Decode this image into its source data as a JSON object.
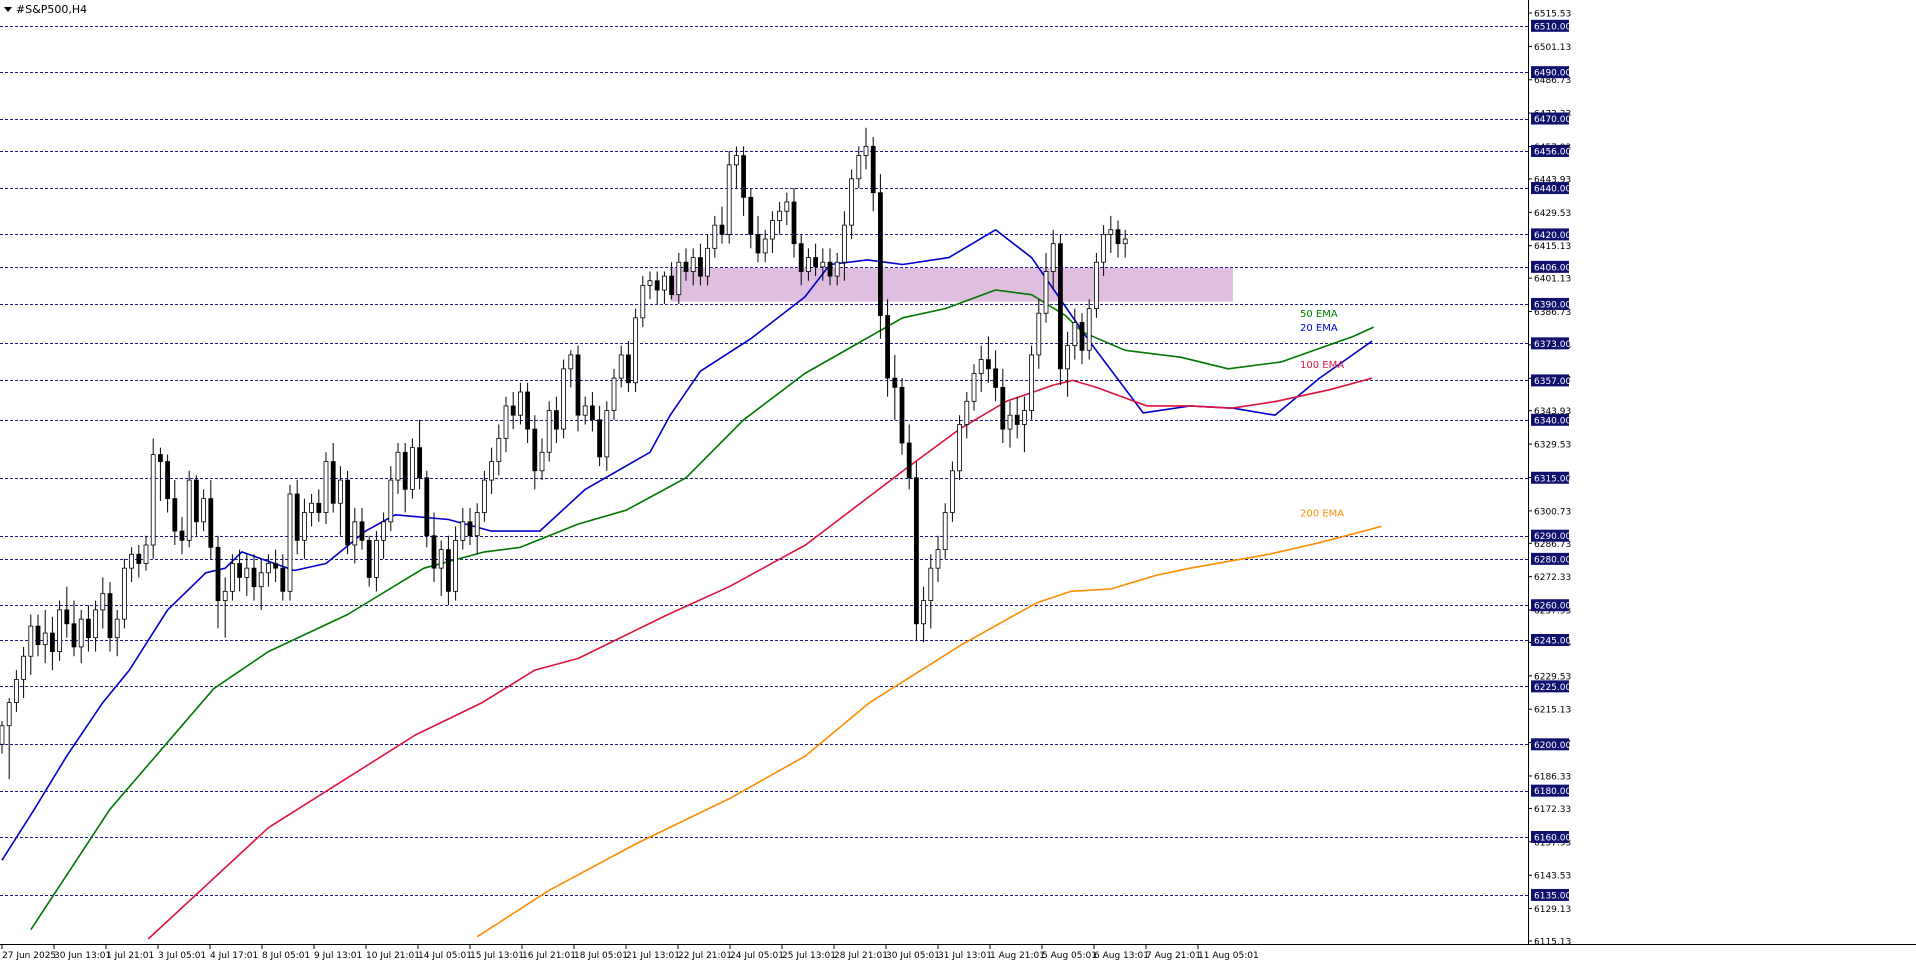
{
  "window": {
    "title": "#S&P500,H4"
  },
  "chart_data": {
    "type": "candlestick",
    "symbol": "#S&P500",
    "timeframe": "H4",
    "ylim": [
      6115.13,
      6522.0
    ],
    "y_ticks": [
      6515.53,
      6501.13,
      6486.73,
      6472.33,
      6457.93,
      6443.93,
      6429.53,
      6415.13,
      6401.13,
      6386.73,
      6372.33,
      6357.93,
      6343.93,
      6329.53,
      6315.13,
      6300.73,
      6286.73,
      6272.33,
      6257.93,
      6243.93,
      6229.53,
      6215.13,
      6200.73,
      6186.33,
      6172.33,
      6157.93,
      6143.53,
      6129.13,
      6115.13
    ],
    "y_tick_labels": [
      "6515.53",
      "6501.13",
      "6486.73",
      "6472.33",
      "6457.93",
      "6443.93",
      "6429.53",
      "6415.13",
      "6401.13",
      "6386.73",
      "6372.33",
      "6357.93",
      "6343.93",
      "6329.53",
      "6315.13",
      "6300.73",
      "6286.73",
      "6272.33",
      "6257.93",
      "6243.93",
      "6229.53",
      "6215.13",
      "6200.73",
      "6186.33",
      "6172.33",
      "6157.93",
      "6143.53",
      "6129.13",
      "6115.13"
    ],
    "levels": [
      6510.0,
      6490.0,
      6470.0,
      6456.0,
      6440.0,
      6420.0,
      6406.0,
      6390.0,
      6373.0,
      6357.0,
      6340.0,
      6315.0,
      6290.0,
      6280.0,
      6260.0,
      6245.0,
      6225.0,
      6200.0,
      6180.0,
      6160.0,
      6135.0
    ],
    "level_labels": [
      "6510.00",
      "6490.00",
      "6470.00",
      "6456.00",
      "6440.00",
      "6420.00",
      "6406.00",
      "6390.00",
      "6373.00",
      "6357.00",
      "6340.00",
      "6315.00",
      "6290.00",
      "6280.00",
      "6260.00",
      "6245.00",
      "6225.00",
      "6200.00",
      "6180.00",
      "6160.00",
      "6135.00"
    ],
    "x_labels": [
      "27 Jun 2025",
      "30 Jun 13:01",
      "1 Jul 21:01",
      "3 Jul 05:01",
      "4 Jul 17:01",
      "8 Jul 05:01",
      "9 Jul 13:01",
      "10 Jul 21:01",
      "14 Jul 05:01",
      "15 Jul 13:01",
      "16 Jul 21:01",
      "18 Jul 05:01",
      "21 Jul 13:01",
      "22 Jul 21:01",
      "24 Jul 05:01",
      "25 Jul 13:01",
      "28 Jul 21:01",
      "30 Jul 05:01",
      "31 Jul 13:01",
      "1 Aug 21:01",
      "5 Aug 05:01",
      "6 Aug 13:01",
      "7 Aug 21:01",
      "11 Aug 05:01"
    ],
    "zone": {
      "low": 6391.0,
      "high": 6405.5
    },
    "series": [
      {
        "name": "20 EMA",
        "color": "#0000cc",
        "x": [
          0,
          4.5,
          9,
          14,
          17.7,
          23,
          28.3,
          31,
          33.3,
          40.6,
          45,
          50.5,
          54.6,
          62,
          68,
          74.7,
          81,
          90,
          92.8,
          97,
          104,
          111.5,
          115,
          120.2,
          125.1,
          131.5,
          138,
          143,
          151,
          158.5,
          165,
          171,
          176.8,
          183,
          190.3
        ],
        "y": [
          6150,
          6172,
          6195,
          6218,
          6232,
          6258,
          6274,
          6276,
          6283,
          6275,
          6278,
          6292,
          6299,
          6297,
          6292,
          6292,
          6310,
          6326,
          6342,
          6361,
          6375,
          6393,
          6407,
          6409,
          6407,
          6410,
          6422,
          6410,
          6374,
          6343,
          6346,
          6345,
          6342,
          6358,
          6374
        ]
      },
      {
        "name": "50 EMA",
        "color": "#007700",
        "x": [
          4,
          15,
          29.4,
          37,
          48,
          58.6,
          67,
          72,
          80,
          86.7,
          95,
          103,
          111.5,
          125.1,
          131,
          138,
          143,
          147.7,
          150,
          156,
          163.7,
          170.3,
          177.7,
          187.7,
          190.5
        ],
        "y": [
          6120,
          6172,
          6224,
          6240,
          6256,
          6276,
          6283,
          6285,
          6295,
          6301,
          6315,
          6340,
          6360,
          6384,
          6388,
          6396,
          6394,
          6385,
          6378,
          6370,
          6367,
          6362,
          6365,
          6376,
          6380
        ]
      },
      {
        "name": "100 EMA",
        "color": "#dc143c",
        "x": [
          20.3,
          37,
          57.4,
          66.7,
          74,
          80,
          92.5,
          101,
          111.6,
          126,
          133,
          139.5,
          146,
          148.7,
          152,
          159,
          165,
          170.8,
          177,
          184.4,
          190.3
        ],
        "y": [
          6116,
          6164,
          6204,
          6218,
          6232,
          6237,
          6256,
          6268,
          6286,
          6320,
          6336,
          6348,
          6355,
          6357,
          6354,
          6346,
          6346,
          6345,
          6348,
          6353,
          6358
        ]
      },
      {
        "name": "200 EMA",
        "color": "#ff8c00",
        "x": [
          66,
          76,
          88,
          101.3,
          111.6,
          120.5,
          133.3,
          143.7,
          148.5,
          154,
          160.4,
          165,
          176,
          183,
          191.6
        ],
        "y": [
          6117,
          6137,
          6157,
          6177,
          6195,
          6218,
          6243,
          6261,
          6266,
          6267,
          6273,
          6276,
          6282,
          6287,
          6294
        ]
      }
    ],
    "candles": [
      [
        6200,
        6210,
        6196,
        6208
      ],
      [
        6208,
        6220,
        6185,
        6218
      ],
      [
        6218,
        6232,
        6214,
        6228
      ],
      [
        6228,
        6242,
        6220,
        6238
      ],
      [
        6238,
        6256,
        6230,
        6251
      ],
      [
        6251,
        6256,
        6238,
        6243
      ],
      [
        6243,
        6258,
        6235,
        6248
      ],
      [
        6248,
        6255,
        6232,
        6240
      ],
      [
        6240,
        6262,
        6236,
        6258
      ],
      [
        6258,
        6268,
        6246,
        6252
      ],
      [
        6252,
        6262,
        6238,
        6242
      ],
      [
        6242,
        6258,
        6235,
        6254
      ],
      [
        6254,
        6260,
        6240,
        6246
      ],
      [
        6246,
        6262,
        6240,
        6258
      ],
      [
        6258,
        6272,
        6250,
        6265
      ],
      [
        6265,
        6270,
        6240,
        6246
      ],
      [
        6246,
        6258,
        6238,
        6254
      ],
      [
        6254,
        6280,
        6250,
        6276
      ],
      [
        6276,
        6285,
        6270,
        6282
      ],
      [
        6282,
        6286,
        6272,
        6278
      ],
      [
        6278,
        6290,
        6275,
        6286
      ],
      [
        6286,
        6332,
        6280,
        6325
      ],
      [
        6325,
        6328,
        6305,
        6322
      ],
      [
        6322,
        6325,
        6300,
        6306
      ],
      [
        6306,
        6314,
        6286,
        6292
      ],
      [
        6292,
        6298,
        6282,
        6288
      ],
      [
        6288,
        6318,
        6285,
        6314
      ],
      [
        6314,
        6316,
        6290,
        6296
      ],
      [
        6296,
        6310,
        6292,
        6306
      ],
      [
        6306,
        6314,
        6280,
        6285
      ],
      [
        6285,
        6290,
        6250,
        6262
      ],
      [
        6262,
        6272,
        6246,
        6266
      ],
      [
        6266,
        6282,
        6262,
        6278
      ],
      [
        6278,
        6284,
        6266,
        6272
      ],
      [
        6272,
        6282,
        6264,
        6276
      ],
      [
        6276,
        6282,
        6262,
        6268
      ],
      [
        6268,
        6280,
        6258,
        6274
      ],
      [
        6274,
        6282,
        6268,
        6278
      ],
      [
        6278,
        6284,
        6270,
        6276
      ],
      [
        6276,
        6282,
        6262,
        6266
      ],
      [
        6266,
        6312,
        6262,
        6308
      ],
      [
        6308,
        6314,
        6282,
        6288
      ],
      [
        6288,
        6306,
        6280,
        6300
      ],
      [
        6300,
        6308,
        6294,
        6304
      ],
      [
        6304,
        6310,
        6296,
        6300
      ],
      [
        6300,
        6326,
        6295,
        6322
      ],
      [
        6322,
        6330,
        6300,
        6304
      ],
      [
        6304,
        6320,
        6290,
        6314
      ],
      [
        6314,
        6318,
        6282,
        6286
      ],
      [
        6286,
        6302,
        6278,
        6296
      ],
      [
        6296,
        6302,
        6284,
        6288
      ],
      [
        6288,
        6290,
        6268,
        6272
      ],
      [
        6272,
        6292,
        6266,
        6288
      ],
      [
        6288,
        6300,
        6280,
        6296
      ],
      [
        6296,
        6320,
        6292,
        6314
      ],
      [
        6314,
        6330,
        6308,
        6326
      ],
      [
        6326,
        6330,
        6300,
        6310
      ],
      [
        6310,
        6332,
        6306,
        6328
      ],
      [
        6328,
        6340,
        6310,
        6315
      ],
      [
        6315,
        6318,
        6285,
        6290
      ],
      [
        6290,
        6300,
        6270,
        6276
      ],
      [
        6276,
        6288,
        6264,
        6284
      ],
      [
        6284,
        6290,
        6260,
        6266
      ],
      [
        6266,
        6294,
        6262,
        6288
      ],
      [
        6288,
        6302,
        6284,
        6296
      ],
      [
        6296,
        6302,
        6286,
        6290
      ],
      [
        6290,
        6304,
        6282,
        6300
      ],
      [
        6300,
        6318,
        6296,
        6314
      ],
      [
        6314,
        6328,
        6308,
        6322
      ],
      [
        6322,
        6338,
        6316,
        6332
      ],
      [
        6332,
        6350,
        6326,
        6346
      ],
      [
        6346,
        6352,
        6336,
        6342
      ],
      [
        6342,
        6356,
        6338,
        6352
      ],
      [
        6352,
        6356,
        6330,
        6336
      ],
      [
        6336,
        6342,
        6310,
        6318
      ],
      [
        6318,
        6332,
        6314,
        6326
      ],
      [
        6326,
        6348,
        6322,
        6344
      ],
      [
        6344,
        6350,
        6330,
        6336
      ],
      [
        6336,
        6366,
        6332,
        6362
      ],
      [
        6362,
        6370,
        6354,
        6368
      ],
      [
        6368,
        6372,
        6335,
        6342
      ],
      [
        6342,
        6350,
        6338,
        6346
      ],
      [
        6346,
        6352,
        6335,
        6340
      ],
      [
        6340,
        6346,
        6320,
        6324
      ],
      [
        6324,
        6348,
        6318,
        6344
      ],
      [
        6344,
        6362,
        6340,
        6358
      ],
      [
        6358,
        6372,
        6354,
        6368
      ],
      [
        6368,
        6374,
        6352,
        6356
      ],
      [
        6356,
        6388,
        6352,
        6384
      ],
      [
        6384,
        6402,
        6380,
        6398
      ],
      [
        6398,
        6404,
        6392,
        6400
      ],
      [
        6400,
        6404,
        6390,
        6396
      ],
      [
        6396,
        6404,
        6390,
        6402
      ],
      [
        6402,
        6408,
        6392,
        6394
      ],
      [
        6394,
        6412,
        6390,
        6408
      ],
      [
        6408,
        6414,
        6400,
        6404
      ],
      [
        6404,
        6414,
        6398,
        6410
      ],
      [
        6410,
        6416,
        6398,
        6402
      ],
      [
        6402,
        6420,
        6398,
        6414
      ],
      [
        6414,
        6428,
        6410,
        6424
      ],
      [
        6424,
        6432,
        6416,
        6420
      ],
      [
        6420,
        6456,
        6416,
        6450
      ],
      [
        6450,
        6458,
        6440,
        6454
      ],
      [
        6454,
        6458,
        6428,
        6436
      ],
      [
        6436,
        6440,
        6414,
        6420
      ],
      [
        6420,
        6428,
        6408,
        6412
      ],
      [
        6412,
        6422,
        6408,
        6418
      ],
      [
        6418,
        6430,
        6412,
        6426
      ],
      [
        6426,
        6434,
        6420,
        6430
      ],
      [
        6430,
        6438,
        6424,
        6434
      ],
      [
        6434,
        6440,
        6410,
        6416
      ],
      [
        6416,
        6420,
        6398,
        6404
      ],
      [
        6404,
        6414,
        6400,
        6410
      ],
      [
        6410,
        6416,
        6402,
        6406
      ],
      [
        6406,
        6414,
        6400,
        6408
      ],
      [
        6408,
        6414,
        6398,
        6402
      ],
      [
        6402,
        6412,
        6398,
        6408
      ],
      [
        6408,
        6430,
        6400,
        6424
      ],
      [
        6424,
        6448,
        6418,
        6444
      ],
      [
        6444,
        6458,
        6440,
        6454
      ],
      [
        6454,
        6466,
        6448,
        6458
      ],
      [
        6458,
        6462,
        6430,
        6438
      ],
      [
        6438,
        6446,
        6375,
        6385
      ],
      [
        6385,
        6392,
        6350,
        6358
      ],
      [
        6358,
        6368,
        6340,
        6354
      ],
      [
        6354,
        6358,
        6325,
        6330
      ],
      [
        6330,
        6338,
        6310,
        6315
      ],
      [
        6315,
        6322,
        6245,
        6252
      ],
      [
        6252,
        6268,
        6244,
        6262
      ],
      [
        6262,
        6282,
        6250,
        6276
      ],
      [
        6276,
        6290,
        6270,
        6284
      ],
      [
        6284,
        6304,
        6280,
        6300
      ],
      [
        6300,
        6322,
        6296,
        6318
      ],
      [
        6318,
        6342,
        6314,
        6338
      ],
      [
        6338,
        6352,
        6332,
        6348
      ],
      [
        6348,
        6364,
        6344,
        6360
      ],
      [
        6360,
        6372,
        6352,
        6366
      ],
      [
        6366,
        6376,
        6356,
        6362
      ],
      [
        6362,
        6370,
        6348,
        6354
      ],
      [
        6354,
        6362,
        6330,
        6336
      ],
      [
        6336,
        6348,
        6328,
        6342
      ],
      [
        6342,
        6350,
        6332,
        6338
      ],
      [
        6338,
        6350,
        6326,
        6344
      ],
      [
        6344,
        6372,
        6340,
        6368
      ],
      [
        6368,
        6392,
        6362,
        6386
      ],
      [
        6386,
        6412,
        6382,
        6404
      ],
      [
        6404,
        6422,
        6396,
        6416
      ],
      [
        6416,
        6420,
        6355,
        6362
      ],
      [
        6362,
        6378,
        6350,
        6372
      ],
      [
        6372,
        6388,
        6366,
        6382
      ],
      [
        6382,
        6386,
        6364,
        6370
      ],
      [
        6370,
        6392,
        6366,
        6388
      ],
      [
        6388,
        6412,
        6384,
        6408
      ],
      [
        6408,
        6424,
        6402,
        6420
      ],
      [
        6420,
        6428,
        6412,
        6422
      ],
      [
        6422,
        6426,
        6410,
        6416
      ],
      [
        6416,
        6422,
        6410,
        6418
      ]
    ]
  }
}
